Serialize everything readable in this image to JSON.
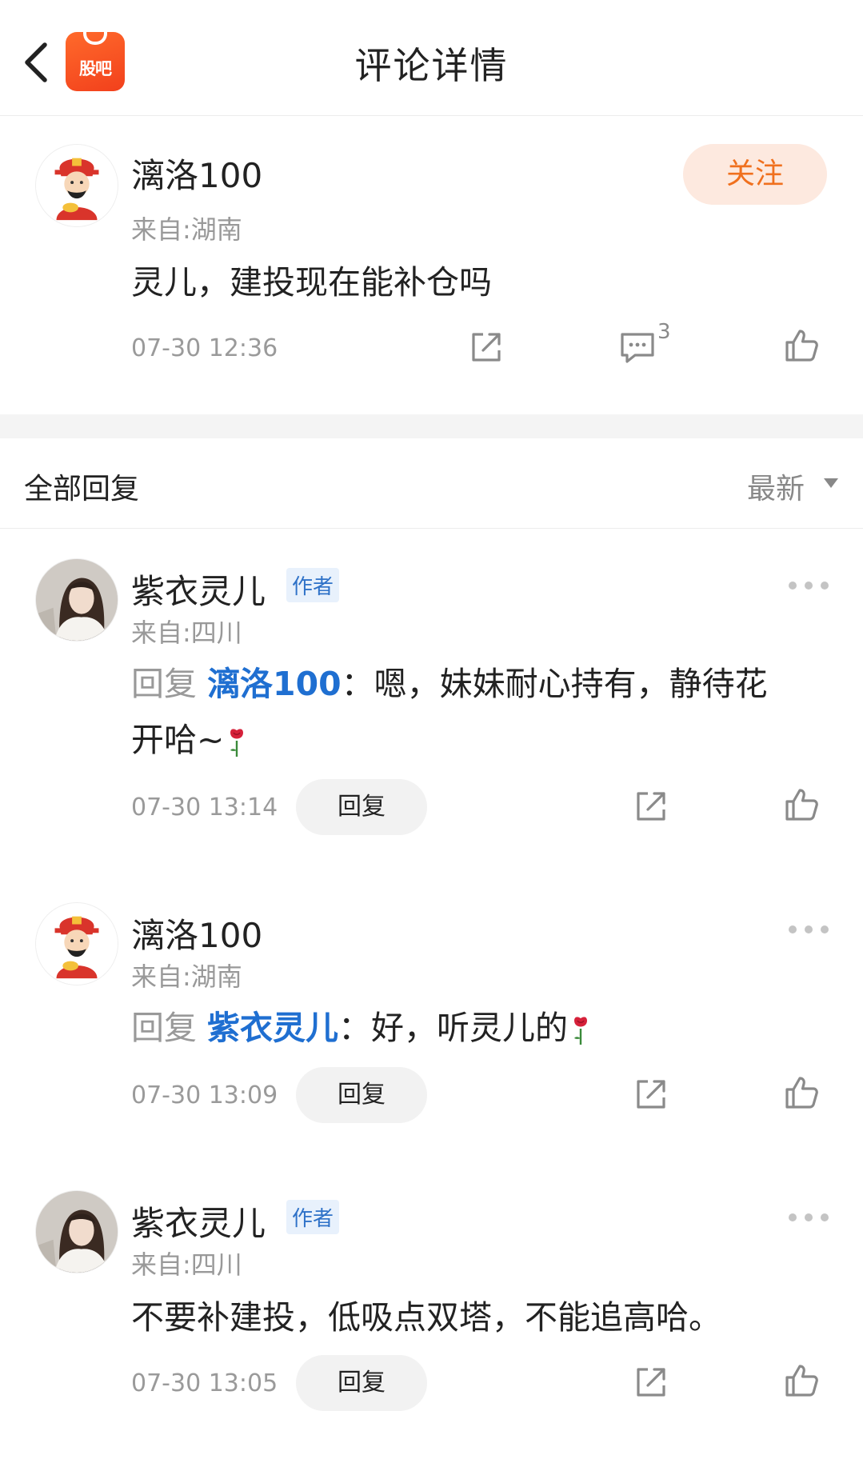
{
  "header": {
    "title": "评论详情",
    "logo_text": "股吧"
  },
  "main_comment": {
    "user": "漓洛100",
    "location": "来自:湖南",
    "follow_label": "关注",
    "text": "灵儿，建投现在能补仓吗",
    "time": "07-30 12:36",
    "reply_count": "3"
  },
  "replies_header": {
    "title": "全部回复",
    "sort_label": "最新"
  },
  "replies": [
    {
      "user": "紫衣灵儿",
      "tag": "作者",
      "location": "来自:四川",
      "reply_prefix": "回复",
      "reply_to": "漓洛100",
      "text_line1": "：嗯，妹妹耐心持有，静待花",
      "text_line2": "开哈~",
      "time": "07-30 13:14",
      "reply_label": "回复"
    },
    {
      "user": "漓洛100",
      "location": "来自:湖南",
      "reply_prefix": "回复",
      "reply_to": "紫衣灵儿",
      "text_line1": "：好，听灵儿的",
      "time": "07-30 13:09",
      "reply_label": "回复"
    },
    {
      "user": "紫衣灵儿",
      "tag": "作者",
      "location": "来自:四川",
      "text_line1": "不要补建投，低吸点双塔，不能追高哈。",
      "time": "07-30 13:05",
      "reply_label": "回复"
    }
  ],
  "colors": {
    "accent_orange": "#f0701e",
    "link_blue": "#1f6fd1",
    "tag_blue": "#2f72c8",
    "muted": "#999999"
  },
  "icons": [
    "back-icon",
    "share-icon",
    "comment-icon",
    "like-icon",
    "more-icon",
    "rose-emoji-icon"
  ]
}
